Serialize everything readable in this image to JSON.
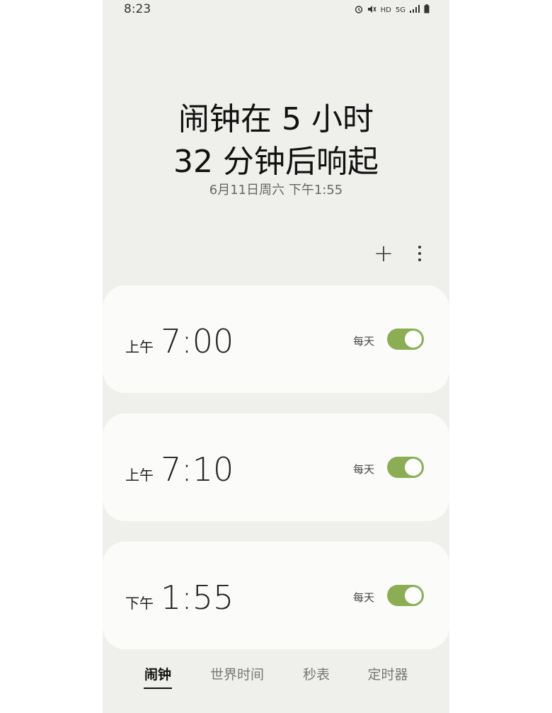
{
  "status_bar": {
    "time": "8:23",
    "icons": [
      "alarm-icon",
      "mute-icon",
      "HD",
      "5G",
      "signal-icon",
      "battery-icon"
    ],
    "hd_label": "HD",
    "network_label": "5G"
  },
  "header": {
    "line1": "闹钟在 5 小时",
    "line2": "32 分钟后响起",
    "next_date": "6月11日周六 下午1:55"
  },
  "toolbar": {
    "add_label": "+",
    "more_icon": "more-vertical-icon"
  },
  "alarms": [
    {
      "period": "上午",
      "time": "7:00",
      "repeat": "每天",
      "enabled": true
    },
    {
      "period": "上午",
      "time": "7:10",
      "repeat": "每天",
      "enabled": true
    },
    {
      "period": "下午",
      "time": "1:55",
      "repeat": "每天",
      "enabled": true
    }
  ],
  "bottom_nav": {
    "tabs": [
      {
        "label": "闹钟",
        "active": true
      },
      {
        "label": "世界时间",
        "active": false
      },
      {
        "label": "秒表",
        "active": false
      },
      {
        "label": "定时器",
        "active": false
      }
    ]
  },
  "colors": {
    "background": "#efefec",
    "card": "#fbfbfa",
    "toggle_on": "#8bae55"
  }
}
